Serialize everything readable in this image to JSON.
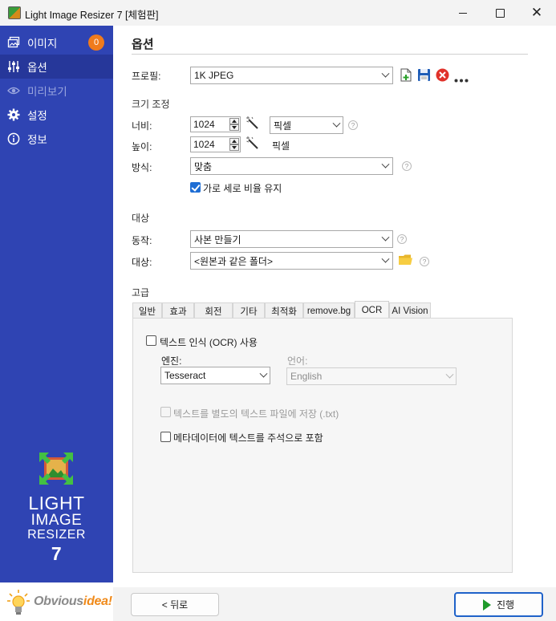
{
  "window": {
    "title": "Light Image Resizer 7  [체험판]",
    "controls": [
      "minimize",
      "maximize",
      "close"
    ]
  },
  "sidebar": {
    "items": [
      {
        "label": "이미지",
        "icon": "images-icon",
        "badge": "0"
      },
      {
        "label": "옵션",
        "icon": "sliders-icon",
        "active": true
      },
      {
        "label": "미리보기",
        "icon": "eye-icon",
        "disabled": true
      },
      {
        "label": "설정",
        "icon": "gear-icon"
      },
      {
        "label": "정보",
        "icon": "info-icon"
      }
    ],
    "logo": {
      "line1": "LIGHT",
      "line2": "IMAGE",
      "line3": "RESIZER",
      "line4": "7"
    },
    "footer": {
      "brand_prefix": "Obvious",
      "brand_suffix": "idea!"
    }
  },
  "options": {
    "title": "옵션",
    "profile": {
      "label": "프로필:",
      "value": "1K JPEG"
    },
    "resize": {
      "group_label": "크기 조정",
      "width_label": "너비:",
      "width_value": "1024",
      "height_label": "높이:",
      "height_value": "1024",
      "unit_value": "픽셀",
      "height_unit": "픽셀",
      "mode_label": "방식:",
      "mode_value": "맞춤",
      "keep_ratio_label": "가로 세로 비율 유지",
      "keep_ratio_checked": true
    },
    "target": {
      "group_label": "대상",
      "action_label": "동작:",
      "action_value": "사본 만들기",
      "dest_label": "대상:",
      "dest_value": "<원본과 같은 폴더>"
    },
    "advanced": {
      "group_label": "고급",
      "tabs": [
        "일반",
        "효과",
        "회전",
        "기타",
        "최적화",
        "remove.bg",
        "OCR",
        "AI Vision"
      ],
      "active_tab": "OCR",
      "ocr": {
        "enable_label": "텍스트 인식 (OCR) 사용",
        "enable_checked": false,
        "engine_label": "엔진:",
        "engine_value": "Tesseract",
        "language_label": "언어:",
        "language_value": "English",
        "save_txt_label": "텍스트를 별도의 텍스트 파일에 저장 (.txt)",
        "metadata_label": "메타데이터에 텍스트를 주석으로 포함"
      }
    }
  },
  "footer_buttons": {
    "back": "< 뒤로",
    "run": "진행"
  },
  "colors": {
    "sidebar": "#2f44b3",
    "sidebar_active": "#26379a",
    "badge": "#f07b1c",
    "accent": "#1f62c9",
    "run_icon": "#1e9a2a"
  }
}
